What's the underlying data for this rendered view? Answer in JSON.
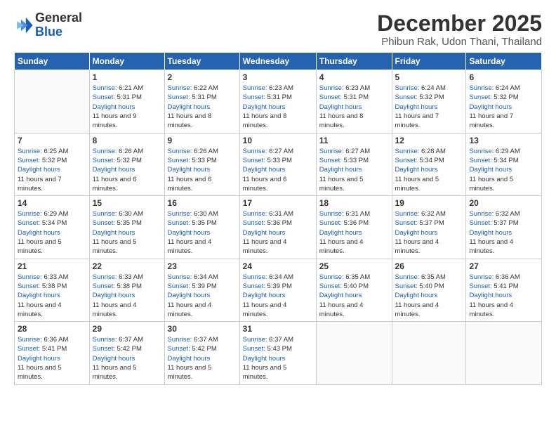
{
  "logo": {
    "line1": "General",
    "line2": "Blue"
  },
  "title": "December 2025",
  "subtitle": "Phibun Rak, Udon Thani, Thailand",
  "weekdays": [
    "Sunday",
    "Monday",
    "Tuesday",
    "Wednesday",
    "Thursday",
    "Friday",
    "Saturday"
  ],
  "weeks": [
    [
      {
        "day": "",
        "sunrise": "",
        "sunset": "",
        "daylight": ""
      },
      {
        "day": "1",
        "sunrise": "6:21 AM",
        "sunset": "5:31 PM",
        "daylight": "11 hours and 9 minutes."
      },
      {
        "day": "2",
        "sunrise": "6:22 AM",
        "sunset": "5:31 PM",
        "daylight": "11 hours and 8 minutes."
      },
      {
        "day": "3",
        "sunrise": "6:23 AM",
        "sunset": "5:31 PM",
        "daylight": "11 hours and 8 minutes."
      },
      {
        "day": "4",
        "sunrise": "6:23 AM",
        "sunset": "5:31 PM",
        "daylight": "11 hours and 8 minutes."
      },
      {
        "day": "5",
        "sunrise": "6:24 AM",
        "sunset": "5:32 PM",
        "daylight": "11 hours and 7 minutes."
      },
      {
        "day": "6",
        "sunrise": "6:24 AM",
        "sunset": "5:32 PM",
        "daylight": "11 hours and 7 minutes."
      }
    ],
    [
      {
        "day": "7",
        "sunrise": "6:25 AM",
        "sunset": "5:32 PM",
        "daylight": "11 hours and 7 minutes."
      },
      {
        "day": "8",
        "sunrise": "6:26 AM",
        "sunset": "5:32 PM",
        "daylight": "11 hours and 6 minutes."
      },
      {
        "day": "9",
        "sunrise": "6:26 AM",
        "sunset": "5:33 PM",
        "daylight": "11 hours and 6 minutes."
      },
      {
        "day": "10",
        "sunrise": "6:27 AM",
        "sunset": "5:33 PM",
        "daylight": "11 hours and 6 minutes."
      },
      {
        "day": "11",
        "sunrise": "6:27 AM",
        "sunset": "5:33 PM",
        "daylight": "11 hours and 5 minutes."
      },
      {
        "day": "12",
        "sunrise": "6:28 AM",
        "sunset": "5:34 PM",
        "daylight": "11 hours and 5 minutes."
      },
      {
        "day": "13",
        "sunrise": "6:29 AM",
        "sunset": "5:34 PM",
        "daylight": "11 hours and 5 minutes."
      }
    ],
    [
      {
        "day": "14",
        "sunrise": "6:29 AM",
        "sunset": "5:34 PM",
        "daylight": "11 hours and 5 minutes."
      },
      {
        "day": "15",
        "sunrise": "6:30 AM",
        "sunset": "5:35 PM",
        "daylight": "11 hours and 5 minutes."
      },
      {
        "day": "16",
        "sunrise": "6:30 AM",
        "sunset": "5:35 PM",
        "daylight": "11 hours and 4 minutes."
      },
      {
        "day": "17",
        "sunrise": "6:31 AM",
        "sunset": "5:36 PM",
        "daylight": "11 hours and 4 minutes."
      },
      {
        "day": "18",
        "sunrise": "6:31 AM",
        "sunset": "5:36 PM",
        "daylight": "11 hours and 4 minutes."
      },
      {
        "day": "19",
        "sunrise": "6:32 AM",
        "sunset": "5:37 PM",
        "daylight": "11 hours and 4 minutes."
      },
      {
        "day": "20",
        "sunrise": "6:32 AM",
        "sunset": "5:37 PM",
        "daylight": "11 hours and 4 minutes."
      }
    ],
    [
      {
        "day": "21",
        "sunrise": "6:33 AM",
        "sunset": "5:38 PM",
        "daylight": "11 hours and 4 minutes."
      },
      {
        "day": "22",
        "sunrise": "6:33 AM",
        "sunset": "5:38 PM",
        "daylight": "11 hours and 4 minutes."
      },
      {
        "day": "23",
        "sunrise": "6:34 AM",
        "sunset": "5:39 PM",
        "daylight": "11 hours and 4 minutes."
      },
      {
        "day": "24",
        "sunrise": "6:34 AM",
        "sunset": "5:39 PM",
        "daylight": "11 hours and 4 minutes."
      },
      {
        "day": "25",
        "sunrise": "6:35 AM",
        "sunset": "5:40 PM",
        "daylight": "11 hours and 4 minutes."
      },
      {
        "day": "26",
        "sunrise": "6:35 AM",
        "sunset": "5:40 PM",
        "daylight": "11 hours and 4 minutes."
      },
      {
        "day": "27",
        "sunrise": "6:36 AM",
        "sunset": "5:41 PM",
        "daylight": "11 hours and 4 minutes."
      }
    ],
    [
      {
        "day": "28",
        "sunrise": "6:36 AM",
        "sunset": "5:41 PM",
        "daylight": "11 hours and 5 minutes."
      },
      {
        "day": "29",
        "sunrise": "6:37 AM",
        "sunset": "5:42 PM",
        "daylight": "11 hours and 5 minutes."
      },
      {
        "day": "30",
        "sunrise": "6:37 AM",
        "sunset": "5:42 PM",
        "daylight": "11 hours and 5 minutes."
      },
      {
        "day": "31",
        "sunrise": "6:37 AM",
        "sunset": "5:43 PM",
        "daylight": "11 hours and 5 minutes."
      },
      {
        "day": "",
        "sunrise": "",
        "sunset": "",
        "daylight": ""
      },
      {
        "day": "",
        "sunrise": "",
        "sunset": "",
        "daylight": ""
      },
      {
        "day": "",
        "sunrise": "",
        "sunset": "",
        "daylight": ""
      }
    ]
  ]
}
